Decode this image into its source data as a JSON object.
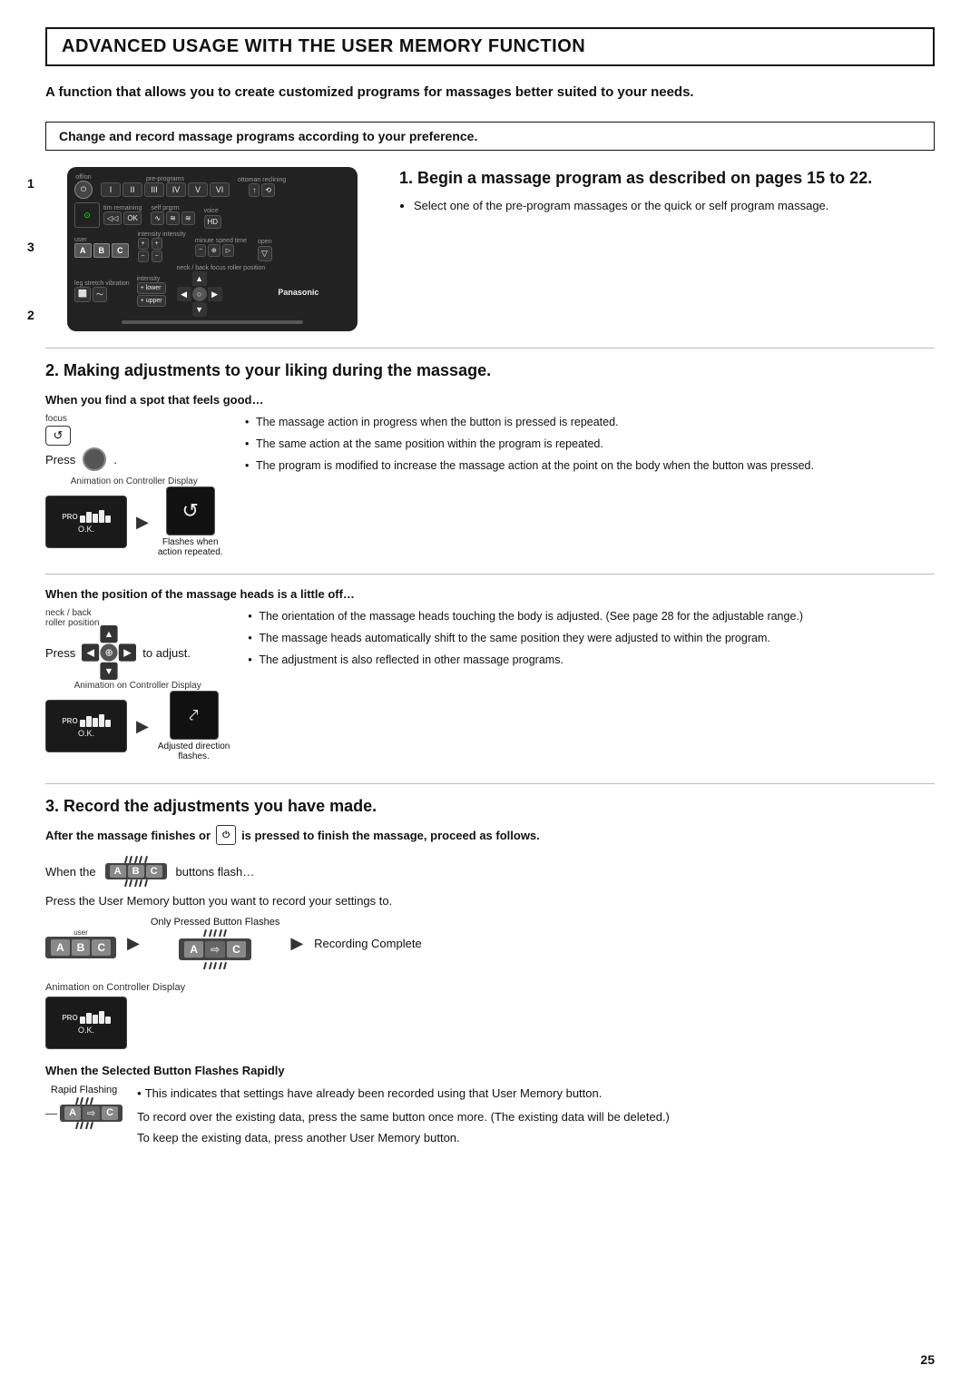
{
  "title": "ADVANCED USAGE WITH THE USER MEMORY FUNCTION",
  "subtitle": "A function that allows you to create customized programs for massages better suited to your needs.",
  "section_box": "Change and record massage programs according to your preference.",
  "step1": {
    "heading": "1. Begin a massage program as described on pages 15 to 22.",
    "bullet1": "Select one of the pre-program massages or the quick or self program massage.",
    "num1": "1",
    "num2": "2",
    "num3": "3"
  },
  "step2": {
    "heading": "2. Making adjustments to your liking during the massage.",
    "substep1": {
      "heading": "When you find a spot that feels good…",
      "press_label": "Press",
      "period": ".",
      "anim_label": "Animation on Controller Display",
      "flashes_label": "Flashes when\naction repeated.",
      "bullets": [
        "The massage action in progress when the button is pressed is repeated.",
        "The same action at the same position within the program is repeated.",
        "The program is modified to increase the massage action at the point on the body when the button was pressed."
      ]
    },
    "substep2": {
      "heading": "When the position of the massage heads is a little off…",
      "press_label": "Press",
      "to_adjust": "to adjust.",
      "anim_label": "Animation on Controller Display",
      "adjusted_label": "Adjusted direction\nflashes.",
      "bullets": [
        "The orientation of the massage heads touching the body is adjusted. (See page 28 for the adjustable range.)",
        "The massage heads automatically shift to the same position they were adjusted to within the program.",
        "The adjustment is also reflected in other massage programs."
      ]
    }
  },
  "step3": {
    "heading": "3. Record the adjustments you have made.",
    "after_note": "After the massage finishes or",
    "after_note2": "is pressed to finish the massage, proceed as follows.",
    "when_the": "When the",
    "buttons_flash": "buttons flash…",
    "press_user_memory": "Press the User Memory button you want to record your settings to.",
    "only_pressed": "Only Pressed Button Flashes",
    "recording_complete": "Recording Complete",
    "anim_label": "Animation on Controller Display",
    "rapid_heading": "When the Selected Button Flashes Rapidly",
    "rapid_label": "Rapid Flashing",
    "rapid_bullet1": "This indicates that settings have already been recorded using that User Memory button.",
    "rapid_text1": "To record over the existing data, press the same button once more. (The existing data will be deleted.)",
    "rapid_text2": "To keep the existing data, press another User Memory button."
  },
  "page_number": "25"
}
